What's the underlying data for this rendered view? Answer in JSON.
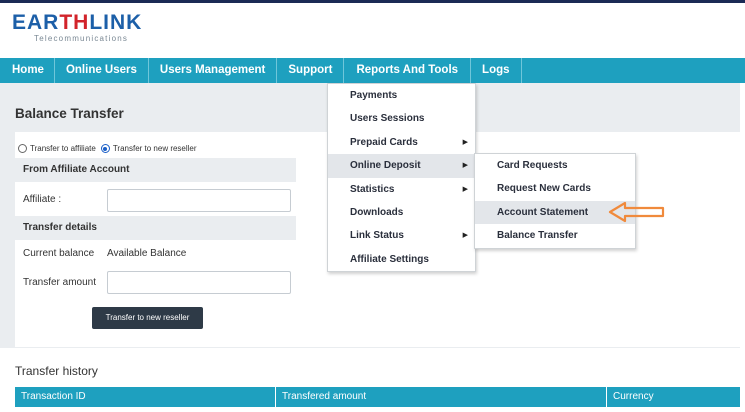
{
  "brand": {
    "logo_text_blue_1": "EAR",
    "logo_text_red": "TH",
    "logo_text_blue_2": "LINK",
    "tagline": "Telecommunications",
    "brand_blue": "#1c5fa8",
    "brand_red": "#d2232a"
  },
  "nav": {
    "accent": "#1ea0bf",
    "items": [
      {
        "label": "Home"
      },
      {
        "label": "Online Users"
      },
      {
        "label": "Users Management"
      },
      {
        "label": "Support"
      },
      {
        "label": "Reports And Tools"
      },
      {
        "label": "Logs"
      }
    ]
  },
  "page": {
    "title": "Balance Transfer",
    "radio_affiliate": "Transfer to affiliate",
    "radio_reseller": "Transfer to new reseller",
    "selected_radio": "Transfer to new reseller",
    "section_from": "From Affiliate Account",
    "affiliate_label": "Affiliate :",
    "affiliate_value": "",
    "section_details": "Transfer details",
    "current_balance_label": "Current balance",
    "current_balance_value": "Available Balance",
    "transfer_amount_label": "Transfer amount",
    "transfer_amount_value": "",
    "submit_button": "Transfer to new reseller"
  },
  "history": {
    "title": "Transfer history",
    "columns": [
      "Transaction ID",
      "Transfered amount",
      "Currency"
    ]
  },
  "reports_menu": {
    "items": [
      {
        "label": "Payments",
        "has_submenu": false
      },
      {
        "label": "Users Sessions",
        "has_submenu": false
      },
      {
        "label": "Prepaid Cards",
        "has_submenu": true
      },
      {
        "label": "Online Deposit",
        "has_submenu": true
      },
      {
        "label": "Statistics",
        "has_submenu": true
      },
      {
        "label": "Downloads",
        "has_submenu": false
      },
      {
        "label": "Link Status",
        "has_submenu": true
      },
      {
        "label": "Affiliate Settings",
        "has_submenu": false
      }
    ],
    "active_item": "Online Deposit",
    "submenu_arrow": "▶"
  },
  "deposit_submenu": {
    "items": [
      {
        "label": "Card Requests"
      },
      {
        "label": "Request New Cards"
      },
      {
        "label": "Account Statement"
      },
      {
        "label": "Balance Transfer"
      }
    ],
    "highlighted_item": "Account Statement"
  },
  "annotation": {
    "arrow_color": "#f08a3c",
    "icon": "left-arrow-callout-icon"
  }
}
